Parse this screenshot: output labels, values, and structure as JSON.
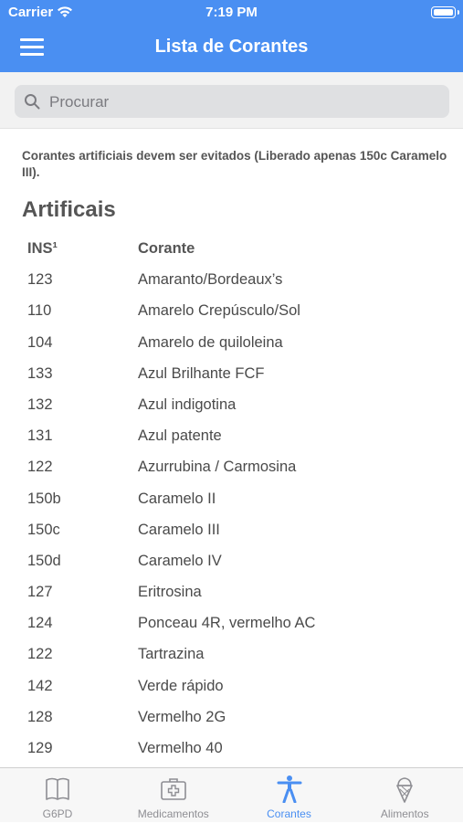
{
  "status_bar": {
    "carrier": "Carrier",
    "time": "7:19 PM"
  },
  "nav": {
    "title": "Lista de Corantes",
    "menu_icon": "hamburger-menu-icon"
  },
  "search": {
    "placeholder": "Procurar",
    "value": "",
    "icon": "search-icon"
  },
  "note": "Corantes artificiais devem ser evitados (Liberado apenas 150c Caramelo III).",
  "section_title": "Artificais",
  "table": {
    "headers": [
      "INS¹",
      "Corante"
    ],
    "rows": [
      [
        "123",
        "Amaranto/Bordeaux’s"
      ],
      [
        "110",
        "Amarelo Crepúsculo/Sol"
      ],
      [
        "104",
        "Amarelo de quiloleina"
      ],
      [
        "133",
        "Azul Brilhante FCF"
      ],
      [
        "132",
        "Azul indigotina"
      ],
      [
        "131",
        "Azul patente"
      ],
      [
        "122",
        "Azurrubina / Carmosina"
      ],
      [
        "150b",
        "Caramelo II"
      ],
      [
        "150c",
        "Caramelo III"
      ],
      [
        "150d",
        "Caramelo IV"
      ],
      [
        "127",
        "Eritrosina"
      ],
      [
        "124",
        "Ponceau 4R, vermelho AC"
      ],
      [
        "122",
        "Tartrazina"
      ],
      [
        "142",
        "Verde rápido"
      ],
      [
        "128",
        "Vermelho 2G"
      ],
      [
        "129",
        "Vermelho 40"
      ]
    ]
  },
  "tabs": [
    {
      "label": "G6PD",
      "icon": "book-icon",
      "active": false
    },
    {
      "label": "Medicamentos",
      "icon": "first-aid-kit-icon",
      "active": false
    },
    {
      "label": "Corantes",
      "icon": "person-accessibility-icon",
      "active": true
    },
    {
      "label": "Alimentos",
      "icon": "ice-cream-icon",
      "active": false
    }
  ],
  "colors": {
    "accent": "#4a8ff2",
    "inactive_tab": "#8e8e93",
    "text": "#4a4a4a"
  }
}
